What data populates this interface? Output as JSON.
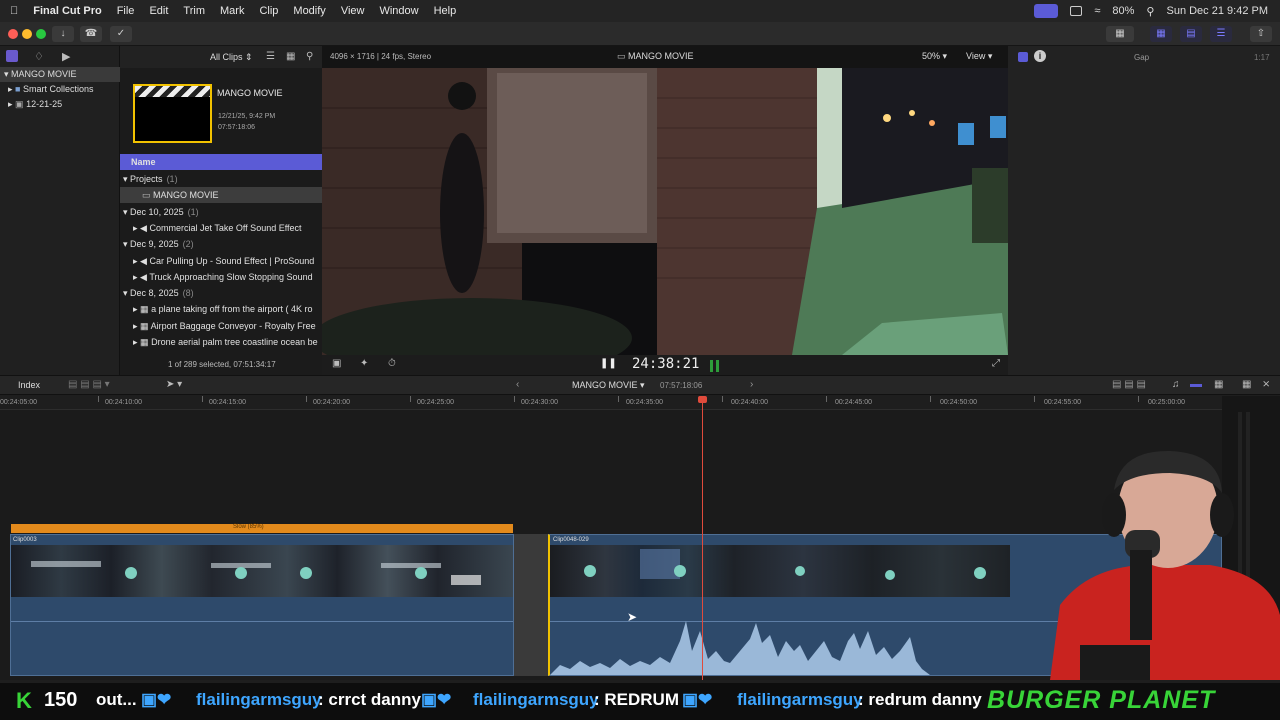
{
  "menubar": {
    "app_name": "Final Cut Pro",
    "items": [
      "File",
      "Edit",
      "Trim",
      "Mark",
      "Clip",
      "Modify",
      "View",
      "Window",
      "Help"
    ],
    "battery": "80%",
    "clock": "Sun Dec 21  9:42 PM"
  },
  "library": {
    "root": "MANGO MOVIE",
    "items": [
      "Smart Collections",
      "12-21-25"
    ]
  },
  "browser": {
    "filter": "All Clips",
    "project_thumb": {
      "title": "MANGO MOVIE",
      "date": "12/21/25, 9:42 PM",
      "duration": "07:57:18:06"
    },
    "column_header": "Name",
    "groups": [
      {
        "label": "Projects",
        "count": "(1)",
        "rows": [
          {
            "name": "MANGO MOVIE"
          }
        ]
      },
      {
        "label": "Dec 10, 2025",
        "count": "(1)",
        "rows": [
          {
            "name": "Commercial Jet Take Off Sound Effect"
          }
        ]
      },
      {
        "label": "Dec 9, 2025",
        "count": "(2)",
        "rows": [
          {
            "name": "Car Pulling Up - Sound Effect  |  ProSound"
          },
          {
            "name": "Truck Approaching Slow Stopping Sound"
          }
        ]
      },
      {
        "label": "Dec 8, 2025",
        "count": "(8)",
        "rows": [
          {
            "name": "a plane taking off from the airport ( 4K ro"
          },
          {
            "name": "Airport Baggage Conveyor - Royalty Free"
          },
          {
            "name": "Drone aerial palm tree coastline ocean be"
          }
        ]
      }
    ],
    "status": "1 of 289 selected, 07:51:34:17"
  },
  "viewer": {
    "format": "4096 × 1716 | 24 fps, Stereo",
    "title": "MANGO MOVIE",
    "zoom": "50%",
    "view_label": "View",
    "timecode": "24:38:21"
  },
  "inspector": {
    "label": "Gap",
    "duration": "1:17"
  },
  "timeline_bar": {
    "index_label": "Index",
    "project": "MANGO MOVIE",
    "duration": "07:57:18:06"
  },
  "ruler": {
    "ticks": [
      "00:24:05:00",
      "00:24:10:00",
      "00:24:15:00",
      "00:24:20:00",
      "00:24:25:00",
      "00:24:30:00",
      "00:24:35:00",
      "00:24:40:00",
      "00:24:45:00",
      "00:24:50:00",
      "00:24:55:00",
      "00:25:00:00"
    ]
  },
  "clips": {
    "clip1_label": "Clip0003",
    "retime_label": "Slow (85%)",
    "clip2_label": "Clip0048-029"
  },
  "ticker": {
    "points_icon": "K",
    "points": "150",
    "messages": [
      {
        "prefix": "out...",
        "user": "",
        "text": ""
      },
      {
        "prefix": "",
        "user": "flailingarmsguy",
        "text": ": crrct danny"
      },
      {
        "prefix": "",
        "user": "flailingarmsguy",
        "text": ": REDRUM"
      },
      {
        "prefix": "",
        "user": "flailingarmsguy",
        "text": ": redrum danny"
      }
    ],
    "brand": "BURGER PLANET"
  },
  "colors": {
    "accent": "#5b5bd6",
    "playhead": "#e04b3c",
    "retime": "#e38a1c",
    "clip": "#2e4a6b",
    "username": "#3ea6ff",
    "brand": "#38d438"
  }
}
